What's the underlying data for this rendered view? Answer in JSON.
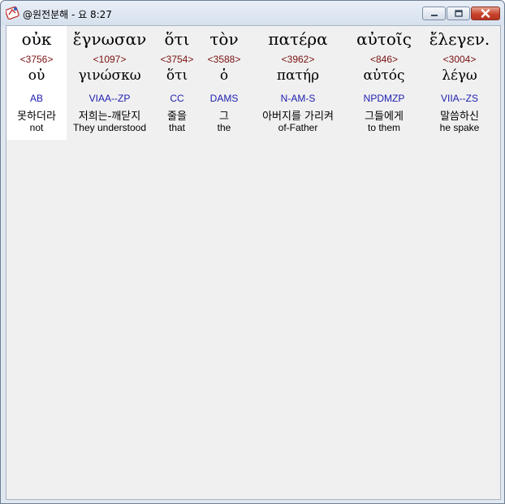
{
  "window": {
    "title": "@원전분해 - 요 8:27"
  },
  "words": [
    {
      "greek": "οὐκ",
      "strong": "<3756>",
      "lemma": "οὐ",
      "morph": "AB",
      "korean": "못하더라",
      "english": "not"
    },
    {
      "greek": "ἔγνωσαν",
      "strong": "<1097>",
      "lemma": "γινώσκω",
      "morph": "VIAA--ZP",
      "korean": "저희는-깨닫지",
      "english": "They understood"
    },
    {
      "greek": "ὅτι",
      "strong": "<3754>",
      "lemma": "ὅτι",
      "morph": "CC",
      "korean": "줄을",
      "english": "that"
    },
    {
      "greek": "τὸν",
      "strong": "<3588>",
      "lemma": "ὁ",
      "morph": "DAMS",
      "korean": "그",
      "english": "the"
    },
    {
      "greek": "πατέρα",
      "strong": "<3962>",
      "lemma": "πατήρ",
      "morph": "N-AM-S",
      "korean": "아버지를 가리켜",
      "english": "of-Father"
    },
    {
      "greek": "αὐτοῖς",
      "strong": "<846>",
      "lemma": "αὐτός",
      "morph": "NPDMZP",
      "korean": "그들에게",
      "english": "to them"
    },
    {
      "greek": "ἔλεγεν.",
      "strong": "<3004>",
      "lemma": "λέγω",
      "morph": "VIIA--ZS",
      "korean": "말씀하신",
      "english": "he spake"
    }
  ]
}
